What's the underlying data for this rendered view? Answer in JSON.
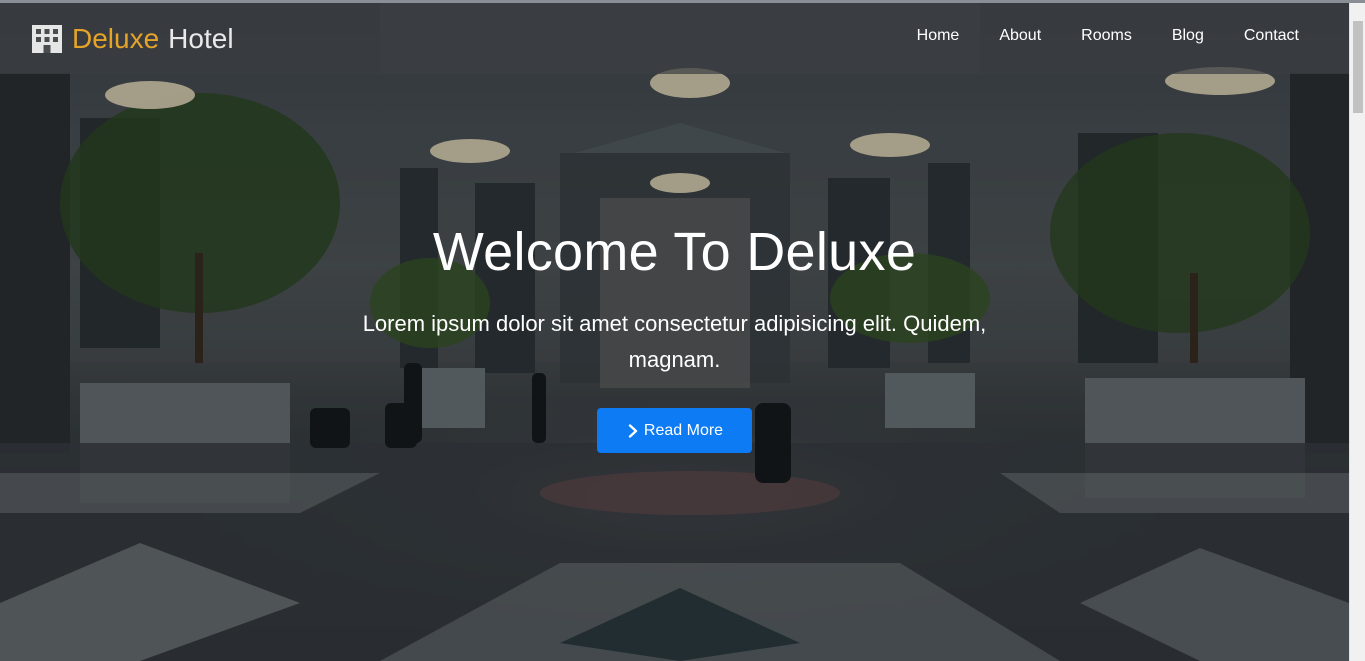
{
  "brand": {
    "part1": "Deluxe",
    "part2": "Hotel",
    "icon": "hotel-building-icon",
    "accent_color": "#e5a427"
  },
  "nav": {
    "items": [
      {
        "label": "Home"
      },
      {
        "label": "About"
      },
      {
        "label": "Rooms"
      },
      {
        "label": "Blog"
      },
      {
        "label": "Contact"
      }
    ]
  },
  "hero": {
    "title": "Welcome To Deluxe",
    "subtitle": "Lorem ipsum dolor sit amet consectetur adipisicing elit. Quidem, magnam.",
    "cta_label": "Read More",
    "cta_icon": "chevron-right-icon",
    "cta_color": "#0d7bf3"
  }
}
